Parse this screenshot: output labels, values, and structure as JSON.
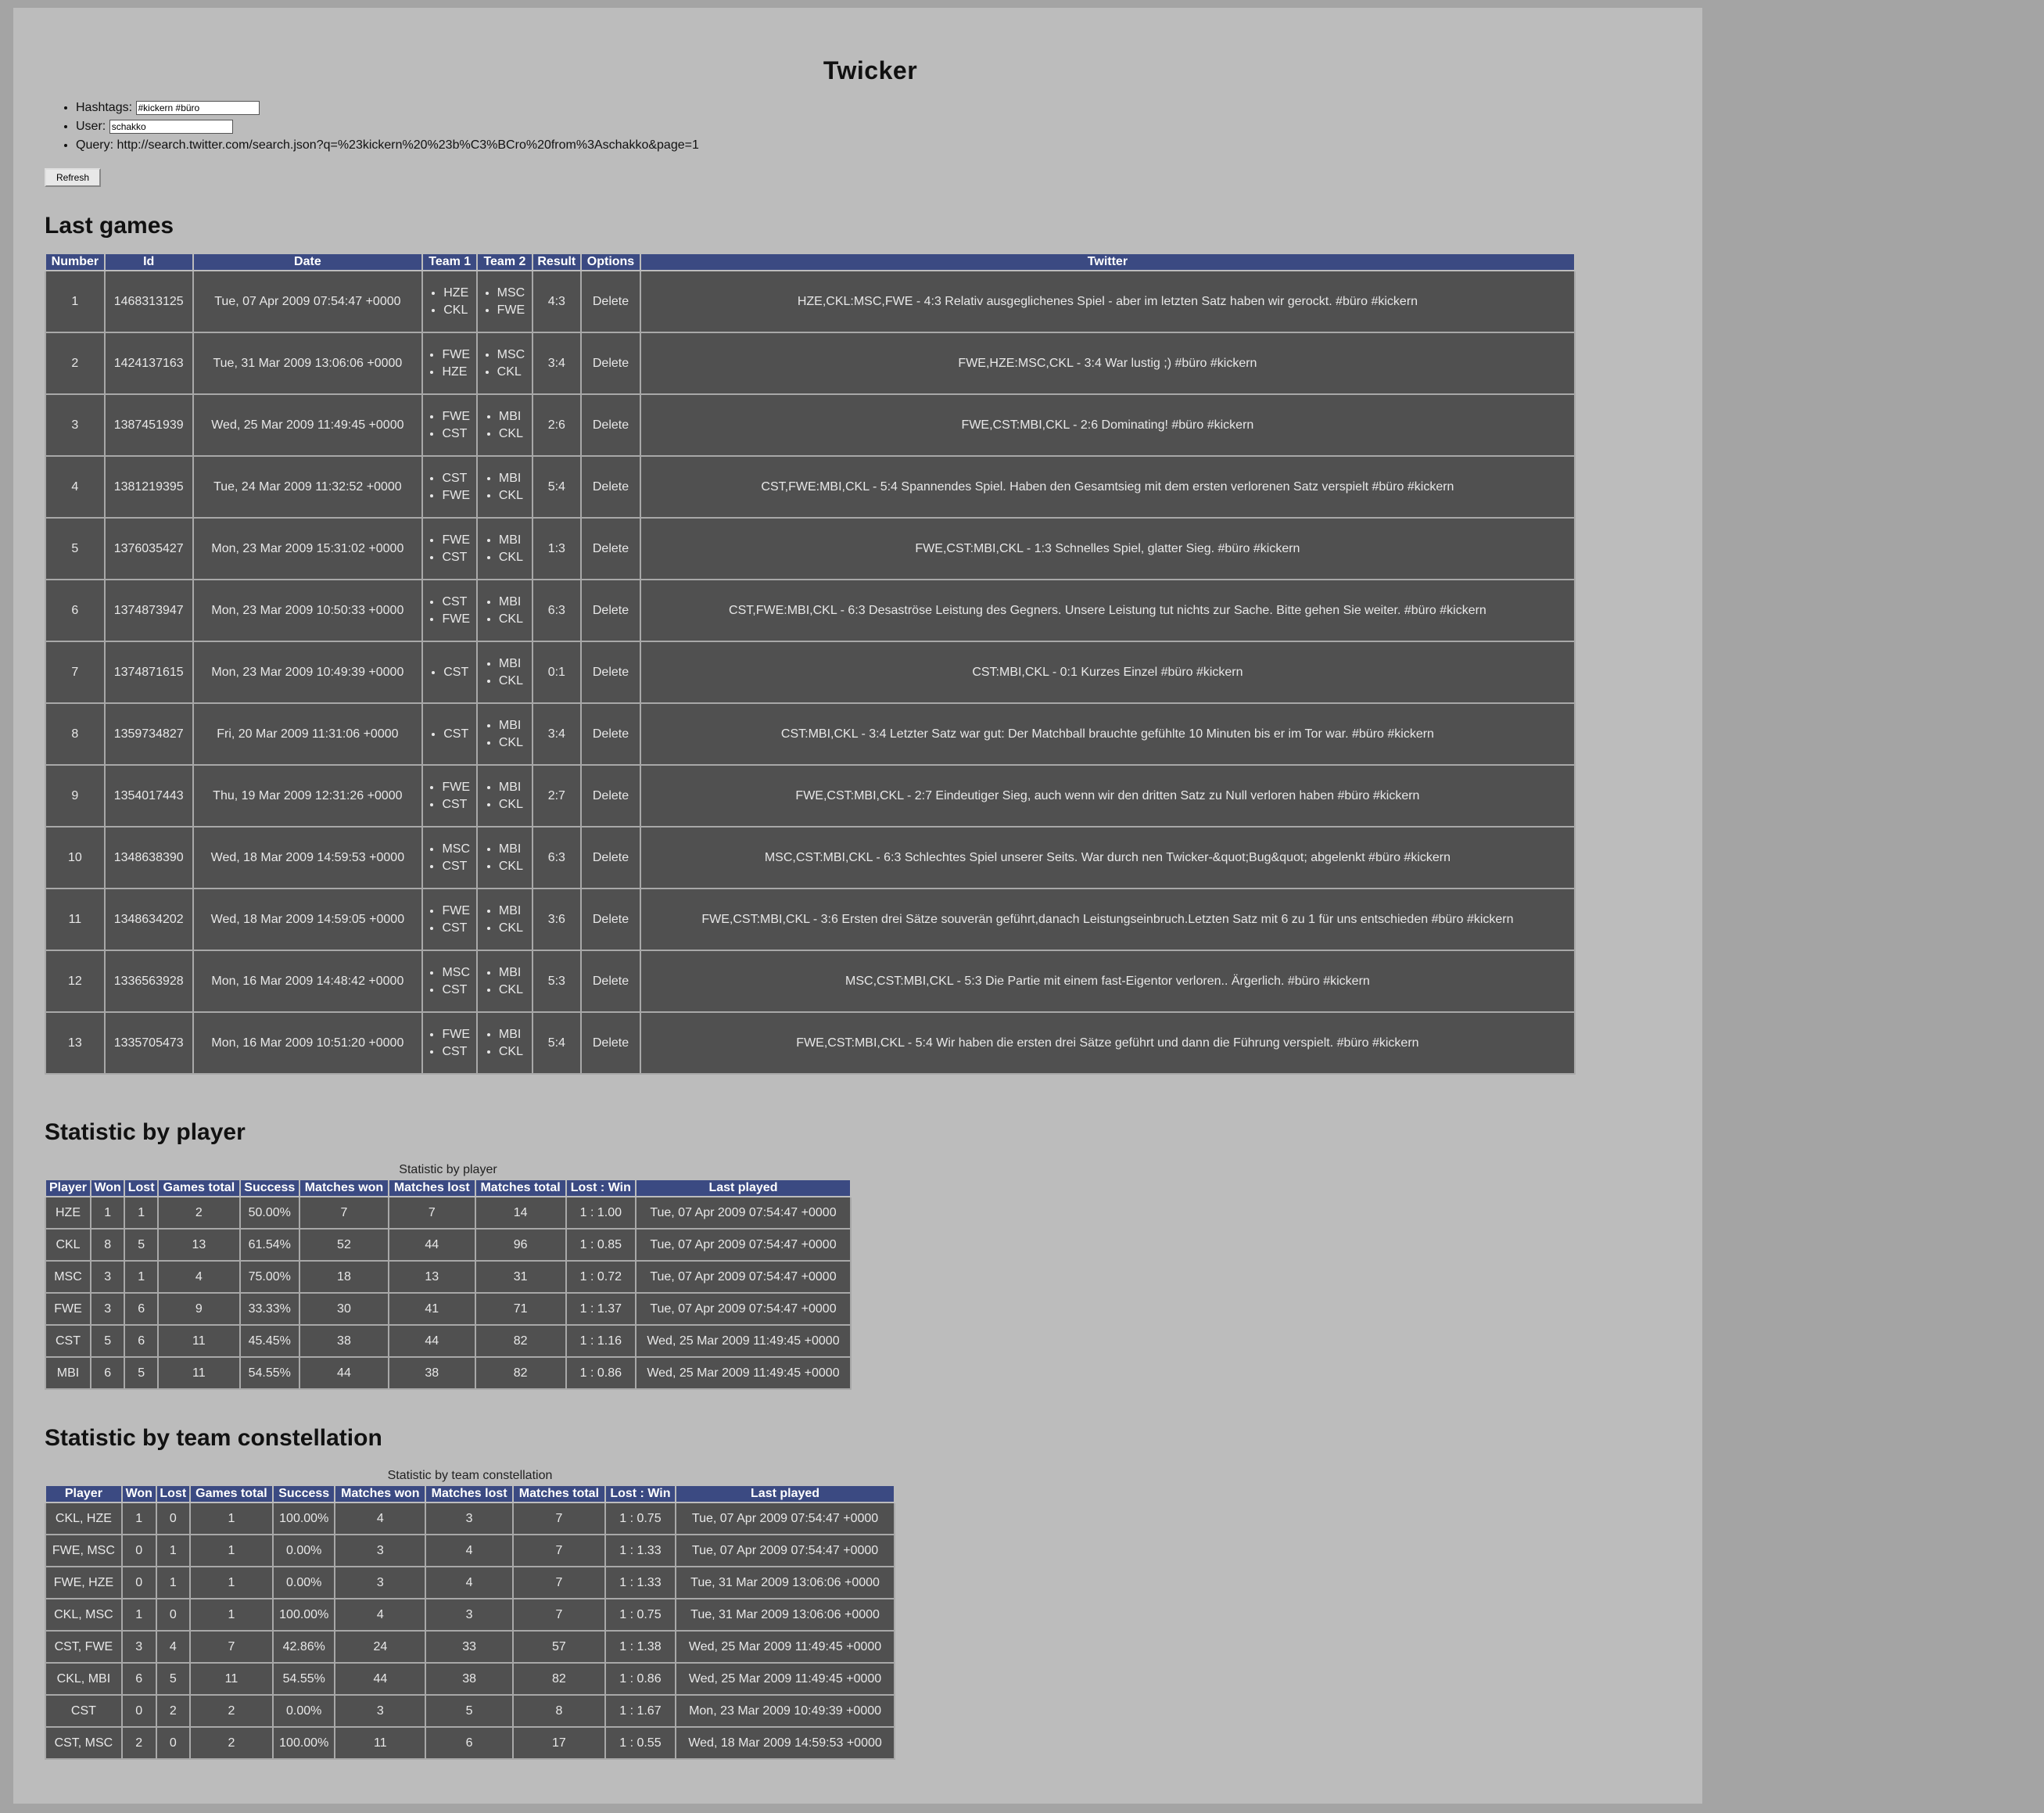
{
  "title": "Twicker",
  "params": {
    "hashtags_label": "Hashtags:",
    "hashtags_value": "#kickern #büro",
    "user_label": "User:",
    "user_value": "schakko",
    "query_label": "Query:",
    "query_value": "http://search.twitter.com/search.json?q=%23kickern%20%23b%C3%BCro%20from%3Aschakko&page=1"
  },
  "refresh_label": "Refresh",
  "games": {
    "heading": "Last games",
    "columns": [
      "Number",
      "Id",
      "Date",
      "Team 1",
      "Team 2",
      "Result",
      "Options",
      "Twitter"
    ],
    "rows": [
      {
        "number": "1",
        "id": "1468313125",
        "date": "Tue, 07 Apr 2009 07:54:47 +0000",
        "team1": [
          "HZE",
          "CKL"
        ],
        "team2": [
          "MSC",
          "FWE"
        ],
        "result": "4:3",
        "option": "Delete",
        "twitter": "HZE,CKL:MSC,FWE - 4:3 Relativ ausgeglichenes Spiel - aber im letzten Satz haben wir gerockt. #büro #kickern"
      },
      {
        "number": "2",
        "id": "1424137163",
        "date": "Tue, 31 Mar 2009 13:06:06 +0000",
        "team1": [
          "FWE",
          "HZE"
        ],
        "team2": [
          "MSC",
          "CKL"
        ],
        "result": "3:4",
        "option": "Delete",
        "twitter": "FWE,HZE:MSC,CKL - 3:4 War lustig ;) #büro #kickern"
      },
      {
        "number": "3",
        "id": "1387451939",
        "date": "Wed, 25 Mar 2009 11:49:45 +0000",
        "team1": [
          "FWE",
          "CST"
        ],
        "team2": [
          "MBI",
          "CKL"
        ],
        "result": "2:6",
        "option": "Delete",
        "twitter": "FWE,CST:MBI,CKL - 2:6 Dominating! #büro #kickern"
      },
      {
        "number": "4",
        "id": "1381219395",
        "date": "Tue, 24 Mar 2009 11:32:52 +0000",
        "team1": [
          "CST",
          "FWE"
        ],
        "team2": [
          "MBI",
          "CKL"
        ],
        "result": "5:4",
        "option": "Delete",
        "twitter": "CST,FWE:MBI,CKL - 5:4 Spannendes Spiel. Haben den Gesamtsieg mit dem ersten verlorenen Satz verspielt #büro #kickern"
      },
      {
        "number": "5",
        "id": "1376035427",
        "date": "Mon, 23 Mar 2009 15:31:02 +0000",
        "team1": [
          "FWE",
          "CST"
        ],
        "team2": [
          "MBI",
          "CKL"
        ],
        "result": "1:3",
        "option": "Delete",
        "twitter": "FWE,CST:MBI,CKL - 1:3 Schnelles Spiel, glatter Sieg. #büro #kickern"
      },
      {
        "number": "6",
        "id": "1374873947",
        "date": "Mon, 23 Mar 2009 10:50:33 +0000",
        "team1": [
          "CST",
          "FWE"
        ],
        "team2": [
          "MBI",
          "CKL"
        ],
        "result": "6:3",
        "option": "Delete",
        "twitter": "CST,FWE:MBI,CKL - 6:3 Desaströse Leistung des Gegners. Unsere Leistung tut nichts zur Sache. Bitte gehen Sie weiter. #büro #kickern"
      },
      {
        "number": "7",
        "id": "1374871615",
        "date": "Mon, 23 Mar 2009 10:49:39 +0000",
        "team1": [
          "CST"
        ],
        "team2": [
          "MBI",
          "CKL"
        ],
        "result": "0:1",
        "option": "Delete",
        "twitter": "CST:MBI,CKL - 0:1 Kurzes Einzel #büro #kickern"
      },
      {
        "number": "8",
        "id": "1359734827",
        "date": "Fri, 20 Mar 2009 11:31:06 +0000",
        "team1": [
          "CST"
        ],
        "team2": [
          "MBI",
          "CKL"
        ],
        "result": "3:4",
        "option": "Delete",
        "twitter": "CST:MBI,CKL - 3:4 Letzter Satz war gut: Der Matchball brauchte gefühlte 10 Minuten bis er im Tor war. #büro #kickern"
      },
      {
        "number": "9",
        "id": "1354017443",
        "date": "Thu, 19 Mar 2009 12:31:26 +0000",
        "team1": [
          "FWE",
          "CST"
        ],
        "team2": [
          "MBI",
          "CKL"
        ],
        "result": "2:7",
        "option": "Delete",
        "twitter": "FWE,CST:MBI,CKL - 2:7 Eindeutiger Sieg, auch wenn wir den dritten Satz zu Null verloren haben #büro #kickern"
      },
      {
        "number": "10",
        "id": "1348638390",
        "date": "Wed, 18 Mar 2009 14:59:53 +0000",
        "team1": [
          "MSC",
          "CST"
        ],
        "team2": [
          "MBI",
          "CKL"
        ],
        "result": "6:3",
        "option": "Delete",
        "twitter": "MSC,CST:MBI,CKL - 6:3 Schlechtes Spiel unserer Seits. War durch nen Twicker-&quot;Bug&quot; abgelenkt #büro #kickern"
      },
      {
        "number": "11",
        "id": "1348634202",
        "date": "Wed, 18 Mar 2009 14:59:05 +0000",
        "team1": [
          "FWE",
          "CST"
        ],
        "team2": [
          "MBI",
          "CKL"
        ],
        "result": "3:6",
        "option": "Delete",
        "twitter": "FWE,CST:MBI,CKL - 3:6 Ersten drei Sätze souverän geführt,danach Leistungseinbruch.Letzten Satz mit 6 zu 1 für uns entschieden #büro #kickern"
      },
      {
        "number": "12",
        "id": "1336563928",
        "date": "Mon, 16 Mar 2009 14:48:42 +0000",
        "team1": [
          "MSC",
          "CST"
        ],
        "team2": [
          "MBI",
          "CKL"
        ],
        "result": "5:3",
        "option": "Delete",
        "twitter": "MSC,CST:MBI,CKL - 5:3 Die Partie mit einem fast-Eigentor verloren.. Ärgerlich. #büro #kickern"
      },
      {
        "number": "13",
        "id": "1335705473",
        "date": "Mon, 16 Mar 2009 10:51:20 +0000",
        "team1": [
          "FWE",
          "CST"
        ],
        "team2": [
          "MBI",
          "CKL"
        ],
        "result": "5:4",
        "option": "Delete",
        "twitter": "FWE,CST:MBI,CKL - 5:4 Wir haben die ersten drei Sätze geführt und dann die Führung verspielt. #büro #kickern"
      }
    ]
  },
  "players": {
    "heading": "Statistic by player",
    "caption": "Statistic by player",
    "columns": [
      "Player",
      "Won",
      "Lost",
      "Games total",
      "Success",
      "Matches won",
      "Matches lost",
      "Matches total",
      "Lost : Win",
      "Last played"
    ],
    "rows": [
      [
        "HZE",
        "1",
        "1",
        "2",
        "50.00%",
        "7",
        "7",
        "14",
        "1 : 1.00",
        "Tue, 07 Apr 2009 07:54:47 +0000"
      ],
      [
        "CKL",
        "8",
        "5",
        "13",
        "61.54%",
        "52",
        "44",
        "96",
        "1 : 0.85",
        "Tue, 07 Apr 2009 07:54:47 +0000"
      ],
      [
        "MSC",
        "3",
        "1",
        "4",
        "75.00%",
        "18",
        "13",
        "31",
        "1 : 0.72",
        "Tue, 07 Apr 2009 07:54:47 +0000"
      ],
      [
        "FWE",
        "3",
        "6",
        "9",
        "33.33%",
        "30",
        "41",
        "71",
        "1 : 1.37",
        "Tue, 07 Apr 2009 07:54:47 +0000"
      ],
      [
        "CST",
        "5",
        "6",
        "11",
        "45.45%",
        "38",
        "44",
        "82",
        "1 : 1.16",
        "Wed, 25 Mar 2009 11:49:45 +0000"
      ],
      [
        "MBI",
        "6",
        "5",
        "11",
        "54.55%",
        "44",
        "38",
        "82",
        "1 : 0.86",
        "Wed, 25 Mar 2009 11:49:45 +0000"
      ]
    ]
  },
  "teams": {
    "heading": "Statistic by team constellation",
    "caption": "Statistic by team constellation",
    "columns": [
      "Player",
      "Won",
      "Lost",
      "Games total",
      "Success",
      "Matches won",
      "Matches lost",
      "Matches total",
      "Lost : Win",
      "Last played"
    ],
    "rows": [
      [
        "CKL, HZE",
        "1",
        "0",
        "1",
        "100.00%",
        "4",
        "3",
        "7",
        "1 : 0.75",
        "Tue, 07 Apr 2009 07:54:47 +0000"
      ],
      [
        "FWE, MSC",
        "0",
        "1",
        "1",
        "0.00%",
        "3",
        "4",
        "7",
        "1 : 1.33",
        "Tue, 07 Apr 2009 07:54:47 +0000"
      ],
      [
        "FWE, HZE",
        "0",
        "1",
        "1",
        "0.00%",
        "3",
        "4",
        "7",
        "1 : 1.33",
        "Tue, 31 Mar 2009 13:06:06 +0000"
      ],
      [
        "CKL, MSC",
        "1",
        "0",
        "1",
        "100.00%",
        "4",
        "3",
        "7",
        "1 : 0.75",
        "Tue, 31 Mar 2009 13:06:06 +0000"
      ],
      [
        "CST, FWE",
        "3",
        "4",
        "7",
        "42.86%",
        "24",
        "33",
        "57",
        "1 : 1.38",
        "Wed, 25 Mar 2009 11:49:45 +0000"
      ],
      [
        "CKL, MBI",
        "6",
        "5",
        "11",
        "54.55%",
        "44",
        "38",
        "82",
        "1 : 0.86",
        "Wed, 25 Mar 2009 11:49:45 +0000"
      ],
      [
        "CST",
        "0",
        "2",
        "2",
        "0.00%",
        "3",
        "5",
        "8",
        "1 : 1.67",
        "Mon, 23 Mar 2009 10:49:39 +0000"
      ],
      [
        "CST, MSC",
        "2",
        "0",
        "2",
        "100.00%",
        "11",
        "6",
        "17",
        "1 : 0.55",
        "Wed, 18 Mar 2009 14:59:53 +0000"
      ]
    ]
  },
  "colors": {
    "page_bg": "#bcbcbc",
    "outer_bg": "#a4a4a4",
    "header_bg": "#3b4a82",
    "cell_bg": "#505050"
  }
}
